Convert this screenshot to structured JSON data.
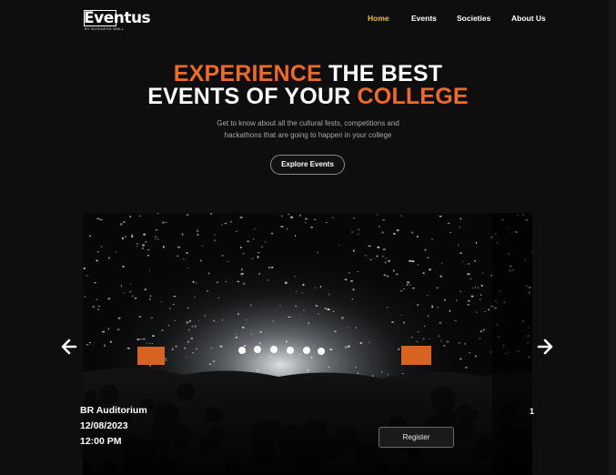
{
  "brand": {
    "name": "Eventus",
    "tagline": "BY BUSINESS WALL"
  },
  "nav": {
    "items": [
      "Home",
      "Events",
      "Societies",
      "About Us"
    ],
    "active": "Home",
    "active_color": "#f2c12e"
  },
  "hero": {
    "line1_accent": "EXPERIENCE",
    "line1_rest": " THE BEST",
    "line2_rest": "EVENTS OF YOUR ",
    "line2_accent": "COLLEGE",
    "accent_color": "#ef6a23",
    "subtitle_line1": "Get to know about all the cultural fests, competitions and",
    "subtitle_line2": "hackathons that are going to happen in your college",
    "cta_label": "Explore Events"
  },
  "carousel": {
    "image": "concert-crowd-confetti",
    "venue": "BR Auditorium",
    "date": "12/08/2023",
    "time": "12:00 PM",
    "register_label": "Register",
    "next_peek": "1",
    "prev_icon": "arrow-left-icon",
    "next_icon": "arrow-right-icon"
  }
}
